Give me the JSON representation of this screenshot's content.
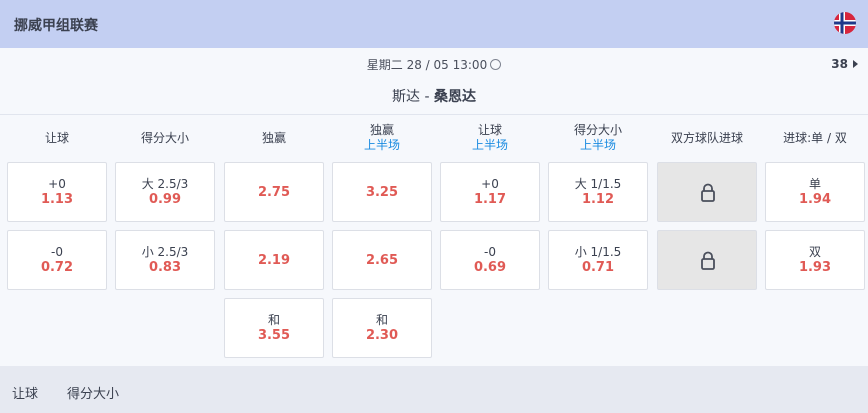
{
  "header": {
    "title": "挪威甲组联赛"
  },
  "match": {
    "datetime": "星期二 28 / 05   13:00",
    "market_count": "38",
    "home": "斯达",
    "separator": " - ",
    "away": "桑恩达"
  },
  "columns": [
    {
      "title": "让球",
      "sub": ""
    },
    {
      "title": "得分大小",
      "sub": ""
    },
    {
      "title": "独赢",
      "sub": ""
    },
    {
      "title": "独赢",
      "sub": "上半场"
    },
    {
      "title": "让球",
      "sub": "上半场"
    },
    {
      "title": "得分大小",
      "sub": "上半场"
    },
    {
      "title": "双方球队进球",
      "sub": ""
    },
    {
      "title": "进球:单 / 双",
      "sub": ""
    }
  ],
  "odds": {
    "r1": [
      {
        "label": "+0",
        "odd": "1.13"
      },
      {
        "label": "大 2.5/3",
        "odd": "0.99"
      },
      {
        "label": "",
        "odd": "2.75"
      },
      {
        "label": "",
        "odd": "3.25"
      },
      {
        "label": "+0",
        "odd": "1.17"
      },
      {
        "label": "大 1/1.5",
        "odd": "1.12"
      },
      {
        "label": "",
        "odd": ""
      },
      {
        "label": "单",
        "odd": "1.94"
      }
    ],
    "r2": [
      {
        "label": "-0",
        "odd": "0.72"
      },
      {
        "label": "小 2.5/3",
        "odd": "0.83"
      },
      {
        "label": "",
        "odd": "2.19"
      },
      {
        "label": "",
        "odd": "2.65"
      },
      {
        "label": "-0",
        "odd": "0.69"
      },
      {
        "label": "小 1/1.5",
        "odd": "0.71"
      },
      {
        "label": "",
        "odd": ""
      },
      {
        "label": "双",
        "odd": "1.93"
      }
    ],
    "r3": [
      {
        "label": "和",
        "odd": "3.55"
      },
      {
        "label": "和",
        "odd": "2.30"
      }
    ]
  },
  "footer": {
    "tab1": "让球",
    "tab2": "得分大小"
  },
  "icons": {
    "flag": "norway-flag-icon",
    "clock": "clock-icon",
    "lock": "lock-icon",
    "arrow": "caret-right-icon"
  }
}
